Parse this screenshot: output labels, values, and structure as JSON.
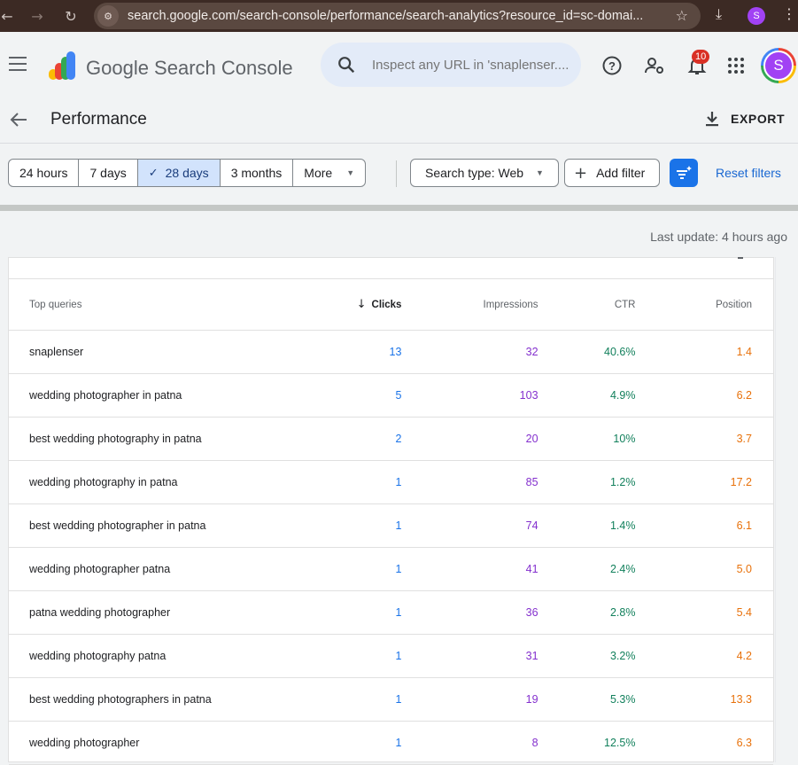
{
  "browser": {
    "url": "search.google.com/search-console/performance/search-analytics?resource_id=sc-domai...",
    "profile_initial": "S"
  },
  "header": {
    "app_name": "Google Search Console",
    "search_placeholder": "Inspect any URL in 'snaplenser....",
    "notification_count": "10",
    "avatar_initial": "S"
  },
  "page": {
    "title": "Performance",
    "export_label": "EXPORT"
  },
  "filters": {
    "ranges": [
      "24 hours",
      "7 days",
      "28 days",
      "3 months",
      "More"
    ],
    "active_range": "28 days",
    "search_type": "Search type: Web",
    "add_filter": "Add filter",
    "reset": "Reset filters"
  },
  "last_update": "Last update: 4 hours ago",
  "table": {
    "columns": [
      "Top queries",
      "Clicks",
      "Impressions",
      "CTR",
      "Position"
    ],
    "sorted_column": "Clicks",
    "rows": [
      {
        "query": "snaplenser",
        "clicks": "13",
        "impressions": "32",
        "ctr": "40.6%",
        "position": "1.4"
      },
      {
        "query": "wedding photographer in patna",
        "clicks": "5",
        "impressions": "103",
        "ctr": "4.9%",
        "position": "6.2"
      },
      {
        "query": "best wedding photography in patna",
        "clicks": "2",
        "impressions": "20",
        "ctr": "10%",
        "position": "3.7"
      },
      {
        "query": "wedding photography in patna",
        "clicks": "1",
        "impressions": "85",
        "ctr": "1.2%",
        "position": "17.2"
      },
      {
        "query": "best wedding photographer in patna",
        "clicks": "1",
        "impressions": "74",
        "ctr": "1.4%",
        "position": "6.1"
      },
      {
        "query": "wedding photographer patna",
        "clicks": "1",
        "impressions": "41",
        "ctr": "2.4%",
        "position": "5.0"
      },
      {
        "query": "patna wedding photographer",
        "clicks": "1",
        "impressions": "36",
        "ctr": "2.8%",
        "position": "5.4"
      },
      {
        "query": "wedding photography patna",
        "clicks": "1",
        "impressions": "31",
        "ctr": "3.2%",
        "position": "4.2"
      },
      {
        "query": "best wedding photographers in patna",
        "clicks": "1",
        "impressions": "19",
        "ctr": "5.3%",
        "position": "13.3"
      },
      {
        "query": "wedding photographer",
        "clicks": "1",
        "impressions": "8",
        "ctr": "12.5%",
        "position": "6.3"
      }
    ]
  },
  "colors": {
    "clicks": "#1a73e8",
    "impressions": "#8430ce",
    "ctr": "#12805c",
    "position": "#e8710a",
    "accent": "#1a73e8"
  }
}
